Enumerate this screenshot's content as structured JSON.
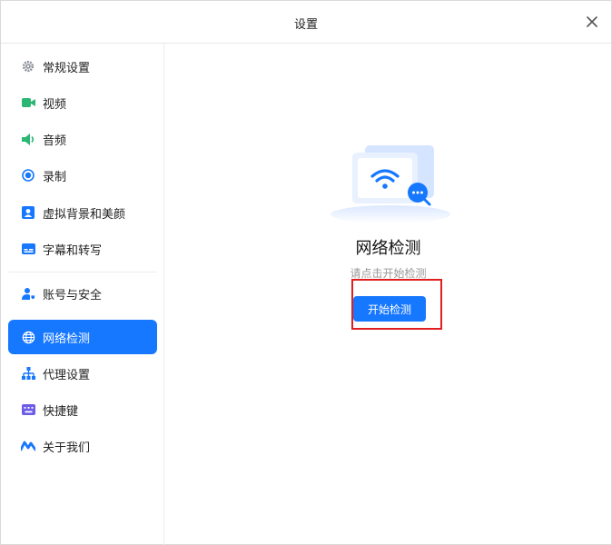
{
  "window": {
    "title": "设置"
  },
  "sidebar": {
    "items": [
      {
        "label": "常规设置",
        "icon": "gear-icon",
        "color": "#8a8f99"
      },
      {
        "label": "视频",
        "icon": "video-camera-icon",
        "color": "#2bb673"
      },
      {
        "label": "音频",
        "icon": "speaker-icon",
        "color": "#2bb673"
      },
      {
        "label": "录制",
        "icon": "record-icon",
        "color": "#1677ff"
      },
      {
        "label": "虚拟背景和美颜",
        "icon": "portrait-icon",
        "color": "#1677ff"
      },
      {
        "label": "字幕和转写",
        "icon": "subtitle-icon",
        "color": "#1677ff"
      },
      {
        "label": "账号与安全",
        "icon": "user-shield-icon",
        "color": "#1677ff"
      },
      {
        "label": "网络检测",
        "icon": "globe-icon",
        "color": "#ffffff",
        "active": true
      },
      {
        "label": "代理设置",
        "icon": "network-tree-icon",
        "color": "#1677ff"
      },
      {
        "label": "快捷键",
        "icon": "keyboard-icon",
        "color": "#6c5ce7"
      },
      {
        "label": "关于我们",
        "icon": "brand-logo-icon",
        "color": "#1677ff"
      }
    ]
  },
  "main": {
    "heading": "网络检测",
    "hint": "请点击开始检测",
    "start_button": "开始检测"
  },
  "colors": {
    "accent": "#1677ff",
    "highlight": "#e02020"
  }
}
